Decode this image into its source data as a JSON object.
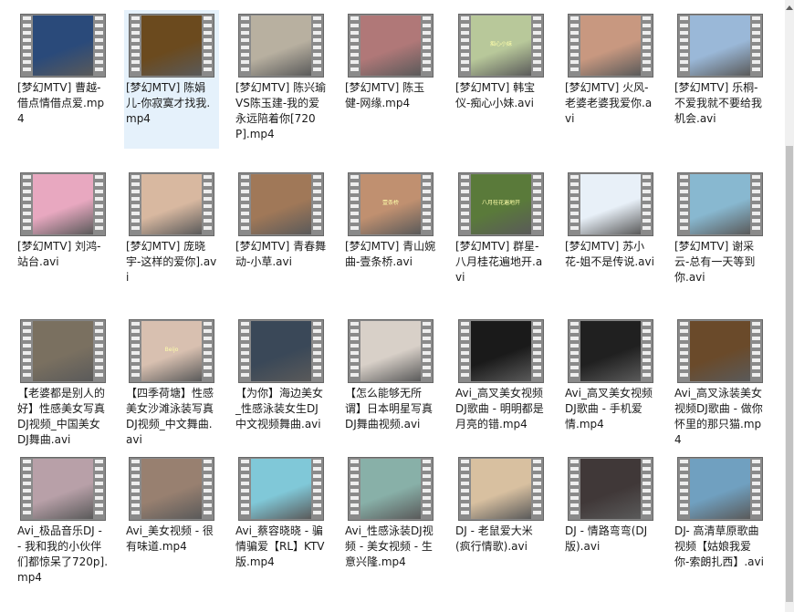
{
  "items": [
    {
      "label": "[梦幻MTV] 曹越-借点情借点爱.mp4",
      "icon": "video-thumbnail",
      "scene": "#2a4a7a",
      "caption": ""
    },
    {
      "label": "[梦幻MTV] 陈娟儿-你寂寞才找我.mp4",
      "icon": "video-thumbnail",
      "scene": "#6b4a1e",
      "caption": ""
    },
    {
      "label": "[梦幻MTV] 陈兴瑜VS陈玉建-我的爱永远陪着你[720P].mp4",
      "icon": "video-thumbnail",
      "scene": "#b8b0a0",
      "caption": ""
    },
    {
      "label": "[梦幻MTV] 陈玉健-网缘.mp4",
      "icon": "video-thumbnail",
      "scene": "#b07878",
      "caption": ""
    },
    {
      "label": "[梦幻MTV] 韩宝仪-痴心小妹.avi",
      "icon": "video-thumbnail",
      "scene": "#b8c89a",
      "caption": "痴心小妹"
    },
    {
      "label": "[梦幻MTV] 火风-老婆老婆我爱你.avi",
      "icon": "video-thumbnail",
      "scene": "#c89880",
      "caption": ""
    },
    {
      "label": "[梦幻MTV] 乐桐-不爱我就不要给我机会.avi",
      "icon": "video-thumbnail",
      "scene": "#9ab8d8",
      "caption": ""
    },
    {
      "label": "[梦幻MTV] 刘鸿-站台.avi",
      "icon": "video-thumbnail",
      "scene": "#e8a8c0",
      "caption": ""
    },
    {
      "label": "[梦幻MTV] 庞晓宇-这样的爱你].avi",
      "icon": "video-thumbnail",
      "scene": "#d8b8a0",
      "caption": ""
    },
    {
      "label": "[梦幻MTV] 青春舞动-小草.avi",
      "icon": "video-thumbnail",
      "scene": "#a07858",
      "caption": ""
    },
    {
      "label": "[梦幻MTV] 青山婉曲-壹条桥.avi",
      "icon": "video-thumbnail",
      "scene": "#c09070",
      "caption": "壹条桥"
    },
    {
      "label": "[梦幻MTV] 群星-八月桂花遍地开.avi",
      "icon": "video-thumbnail",
      "scene": "#5a7a3a",
      "caption": "八月桂花遍地开"
    },
    {
      "label": "[梦幻MTV] 苏小花-姐不是传说.avi",
      "icon": "video-thumbnail",
      "scene": "#e8f0f8",
      "caption": ""
    },
    {
      "label": "[梦幻MTV] 谢采云-总有一天等到你.avi",
      "icon": "video-thumbnail",
      "scene": "#88b8d0",
      "caption": ""
    },
    {
      "label": "【老婆都是别人的好】性感美女写真DJ视频_中国美女DJ舞曲.avi",
      "icon": "video-thumbnail",
      "scene": "#7a7060",
      "caption": ""
    },
    {
      "label": "【四季荷塘】性感美女沙滩泳装写真DJ视频_中文舞曲.avi",
      "icon": "video-thumbnail",
      "scene": "#d8c0b0",
      "caption": "Beijo"
    },
    {
      "label": "【为你】海边美女_性感泳装女生DJ中文视频舞曲.avi",
      "icon": "video-thumbnail",
      "scene": "#3a4858",
      "caption": ""
    },
    {
      "label": "【怎么能够无所谓】日本明星写真DJ舞曲视频.avi",
      "icon": "video-thumbnail",
      "scene": "#d8d0c8",
      "caption": ""
    },
    {
      "label": "Avi_高叉美女视频DJ歌曲 - 明明都是月亮的错.mp4",
      "icon": "video-thumbnail",
      "scene": "#1a1a1a",
      "caption": ""
    },
    {
      "label": "Avi_高叉美女视频DJ歌曲 - 手机爱情.mp4",
      "icon": "video-thumbnail",
      "scene": "#202020",
      "caption": ""
    },
    {
      "label": "Avi_高叉泳装美女视频DJ歌曲 - 做你怀里的那只猫.mp4",
      "icon": "video-thumbnail",
      "scene": "#6a4a2a",
      "caption": ""
    },
    {
      "label": "Avi_极品音乐DJ - - 我和我的小伙伴们都惊呆了720p].mp4",
      "icon": "video-thumbnail",
      "scene": "#b8a0a8",
      "caption": ""
    },
    {
      "label": "Avi_美女视频 - 很有味道.mp4",
      "icon": "video-thumbnail",
      "scene": "#988070",
      "caption": ""
    },
    {
      "label": "Avi_蔡容晓晓 - 骗情骗爱【RL】KTV版.mp4",
      "icon": "video-thumbnail",
      "scene": "#80c8d8",
      "caption": ""
    },
    {
      "label": "Avi_性感泳装DJ视频 - 美女视频 - 生意兴隆.mp4",
      "icon": "video-thumbnail",
      "scene": "#88b0a8",
      "caption": ""
    },
    {
      "label": "DJ - 老鼠爱大米(疯行情歌).avi",
      "icon": "video-thumbnail",
      "scene": "#d8c0a0",
      "caption": ""
    },
    {
      "label": "DJ - 情路弯弯(DJ版).avi",
      "icon": "video-thumbnail",
      "scene": "#403838",
      "caption": ""
    },
    {
      "label": "DJ- 高清草原歌曲视频【姑娘我爱你-索朗扎西】.avi",
      "icon": "video-thumbnail",
      "scene": "#70a0c0",
      "caption": ""
    }
  ],
  "selected_index": 1
}
